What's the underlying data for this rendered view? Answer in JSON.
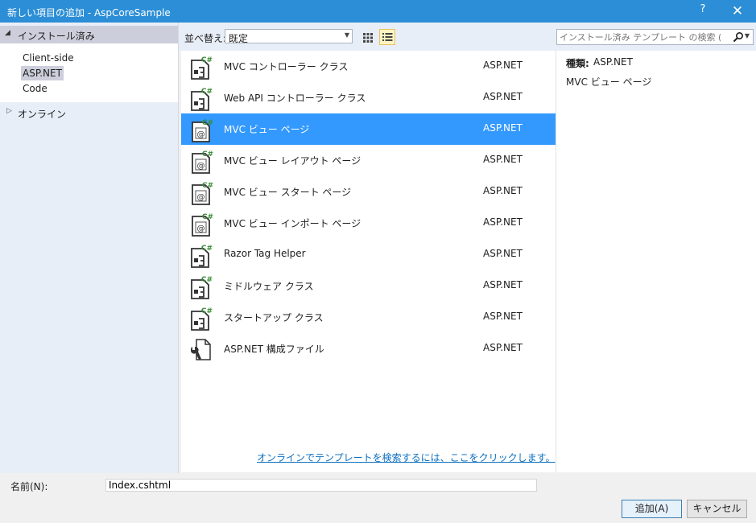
{
  "window": {
    "title": "新しい項目の追加 - AspCoreSample",
    "help": "?",
    "close": "✕"
  },
  "sidebar": {
    "installed_label": "インストール済み",
    "installed_items": [
      {
        "label": "Client-side"
      },
      {
        "label": "ASP.NET"
      },
      {
        "label": "Code"
      }
    ],
    "online_label": "オンライン"
  },
  "toolbar": {
    "sort_label": "並べ替え:",
    "sort_value": "既定",
    "search_placeholder": "インストール済み テンプレート の検索 (Ctrl+E"
  },
  "templates": [
    {
      "name": "MVC コントローラー クラス",
      "lang": "ASP.NET",
      "icon": "cs-class-icon"
    },
    {
      "name": "Web API コントローラー クラス",
      "lang": "ASP.NET",
      "icon": "cs-class-icon"
    },
    {
      "name": "MVC ビュー ページ",
      "lang": "ASP.NET",
      "icon": "razor-page-icon"
    },
    {
      "name": "MVC ビュー レイアウト ページ",
      "lang": "ASP.NET",
      "icon": "razor-page-icon"
    },
    {
      "name": "MVC ビュー スタート ページ",
      "lang": "ASP.NET",
      "icon": "razor-page-icon"
    },
    {
      "name": "MVC ビュー インポート ページ",
      "lang": "ASP.NET",
      "icon": "razor-page-icon"
    },
    {
      "name": "Razor Tag Helper",
      "lang": "ASP.NET",
      "icon": "cs-class-icon"
    },
    {
      "name": "ミドルウェア クラス",
      "lang": "ASP.NET",
      "icon": "cs-class-icon"
    },
    {
      "name": "スタートアップ クラス",
      "lang": "ASP.NET",
      "icon": "cs-class-icon"
    },
    {
      "name": "ASP.NET 構成ファイル",
      "lang": "ASP.NET",
      "icon": "config-file-icon"
    }
  ],
  "online_link": "オンラインでテンプレートを検索するには、ここをクリックします。",
  "info": {
    "type_label": "種類:",
    "type_value": "ASP.NET",
    "description": "MVC ビュー ページ"
  },
  "name_field": {
    "label": "名前(N):",
    "value": "Index.cshtml"
  },
  "buttons": {
    "add": "追加(A)",
    "cancel": "キャンセル"
  },
  "colors": {
    "titlebar": "#2b8ed6",
    "selection": "#3399ff",
    "csharp_badge": "#388a34",
    "link": "#0e70c0"
  }
}
